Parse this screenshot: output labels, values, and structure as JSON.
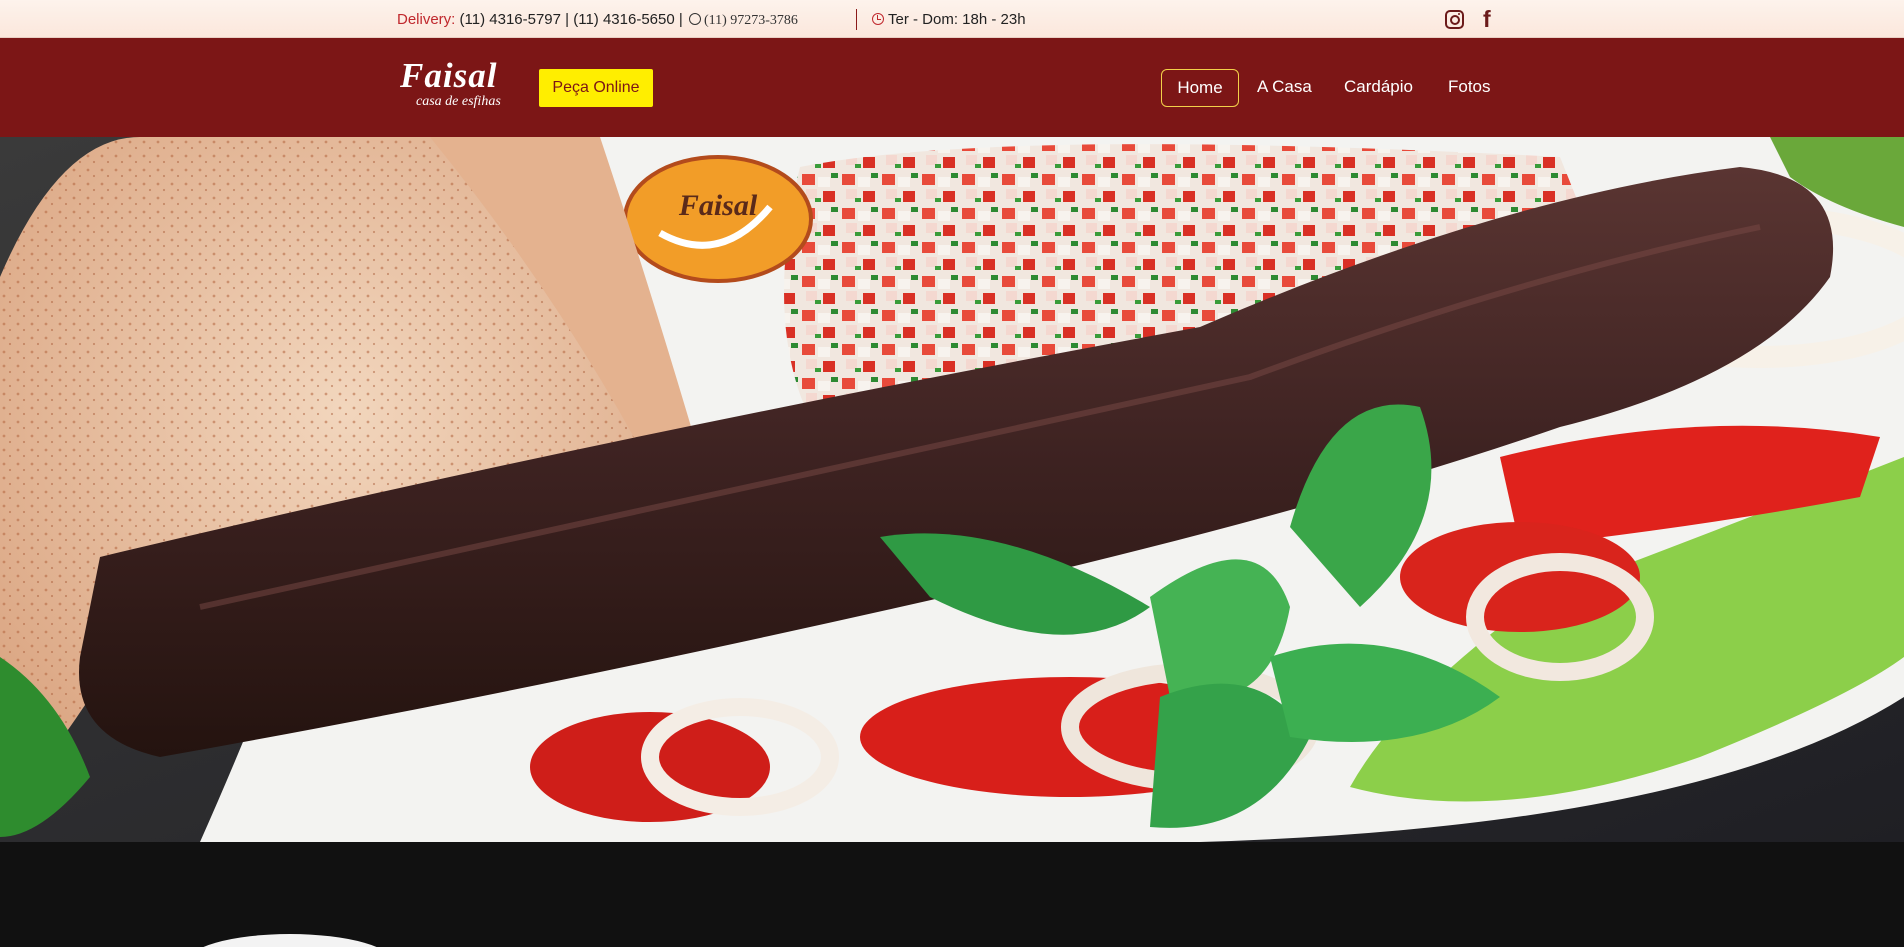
{
  "topbar": {
    "delivery_label": "Delivery:",
    "phones": "(11) 4316-5797 | (11) 4316-5650 |",
    "whatsapp": "(11) 97273-3786",
    "hours": "Ter - Dom: 18h - 23h",
    "icons": [
      "whatsapp-icon",
      "clock-icon",
      "instagram-icon",
      "facebook-icon"
    ]
  },
  "brand": {
    "name": "Faisal",
    "tagline": "casa de esfihas"
  },
  "order_button": "Peça Online",
  "nav": {
    "items": [
      "Home",
      "A Casa",
      "Cardápio",
      "Fotos"
    ],
    "active": "Home"
  },
  "hero": {
    "plate_logo": "Faisal"
  },
  "colors": {
    "primary": "#7c1616",
    "accent": "#ffee00",
    "topbar_bg": "#fdf3ec",
    "delivery_label": "#c0282d"
  }
}
